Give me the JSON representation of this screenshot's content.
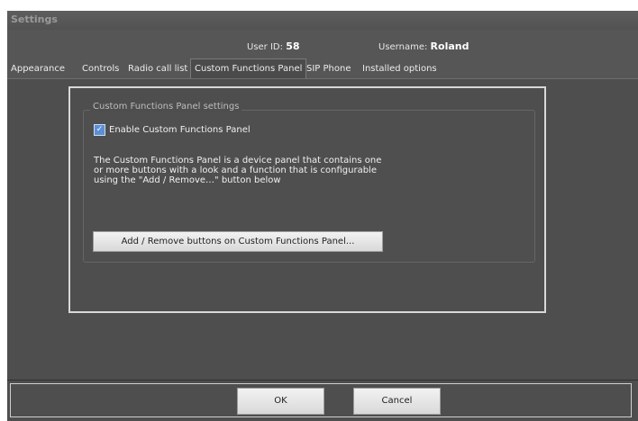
{
  "window": {
    "title": "Settings"
  },
  "user": {
    "id_label": "User ID:",
    "id_value": "58",
    "name_label": "Username:",
    "name_value": "Roland"
  },
  "tabs": [
    {
      "label": "Appearance",
      "active": false
    },
    {
      "label": "Controls",
      "active": false
    },
    {
      "label": "Radio call list",
      "active": false
    },
    {
      "label": "Custom Functions Panel",
      "active": true
    },
    {
      "label": "SIP Phone",
      "active": false
    },
    {
      "label": "Installed options",
      "active": false
    }
  ],
  "panel": {
    "group_title": "Custom Functions Panel settings",
    "enable_checkbox": {
      "label": "Enable Custom Functions Panel",
      "checked": true,
      "check_glyph": "✓"
    },
    "description": "The Custom Functions Panel is a device panel that contains one or more buttons with a look and a function that is configurable using the \"Add / Remove…\" button below",
    "add_remove_button": "Add / Remove buttons on Custom Functions Panel..."
  },
  "footer": {
    "ok_label": "OK",
    "cancel_label": "Cancel"
  },
  "colors": {
    "window_bg": "#565656",
    "panel_bg": "#4e4e4e",
    "checkbox_accent": "#5c8fd6"
  }
}
